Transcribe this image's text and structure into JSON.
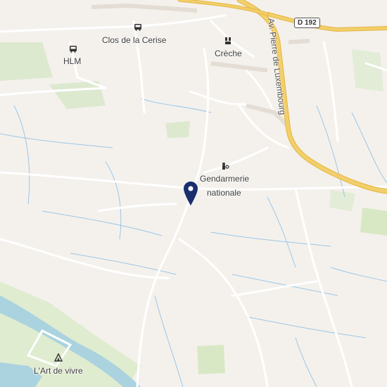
{
  "map": {
    "places": {
      "clos_de_la_cerise": "Clos de la Cerise",
      "hlm": "HLM",
      "creche": "Crèche",
      "gendarmerie_line1": "Gendarmerie",
      "gendarmerie_line2": "nationale",
      "art_de_vivre": "L'Art de vivre"
    },
    "roads": {
      "shield": "D 192",
      "avenue": "Av. Pierre de Luxembourg"
    },
    "icons": {
      "bus": "bus-icon",
      "creche": "creche-icon",
      "police": "police-icon",
      "camping": "camping-icon",
      "marker": "location-pin-icon"
    },
    "colors": {
      "background": "#f4f1ec",
      "water": "#aad3df",
      "stream": "#9cc6e8",
      "major_road": "#f2cf6a",
      "minor_road": "#ffffff",
      "green": "#d8e8c4",
      "pin": "#1a2e6e"
    }
  }
}
